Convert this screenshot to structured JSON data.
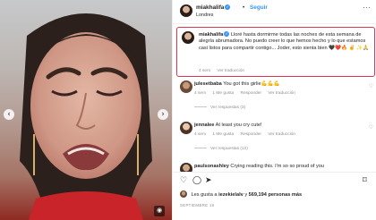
{
  "post": {
    "username": "miakhalifa",
    "follow_label": "Seguir",
    "location": "Londres",
    "more_icon": "more-dots-icon"
  },
  "caption": {
    "username": "miakhalifa",
    "text": "Lloré hasta dormirme todas las noches de esta semana de alegría abrumadora. No puedo creer lo que hemos hecho y lo que estamos casi listos para compartir contigo... Joder, esto sienta bien 🖤❤️🔥 ✌️ ✨🙏",
    "time": "4 sem",
    "translate": "Ver traducción"
  },
  "comments": [
    {
      "username": "julesetbaba",
      "text": "You got this girlie💪💪💪",
      "time": "4 sem",
      "likes": "1 Me gusta",
      "reply": "Responder",
      "translate": "Ver traducción",
      "replies": "Ver respuestas (3)"
    },
    {
      "username": "jennalee",
      "text": "At least you cry cute!",
      "time": "4 sem",
      "likes": "1 Me gusta",
      "reply": "Responder",
      "translate": "Ver traducción",
      "replies": "Ver respuestas (12)"
    },
    {
      "username": "paulsonashley",
      "text": "Crying reading this. I'm so so proud of you"
    }
  ],
  "footer": {
    "likes_prefix": "Les gusta a",
    "likes_user": "iezekielalv",
    "likes_y": "y",
    "likes_count": "569,194 personas más",
    "date": "SEPTIEMBRE 16"
  },
  "icons": {
    "heart": "heart-icon",
    "comment": "comment-icon",
    "share": "share-icon",
    "save": "bookmark-icon"
  }
}
